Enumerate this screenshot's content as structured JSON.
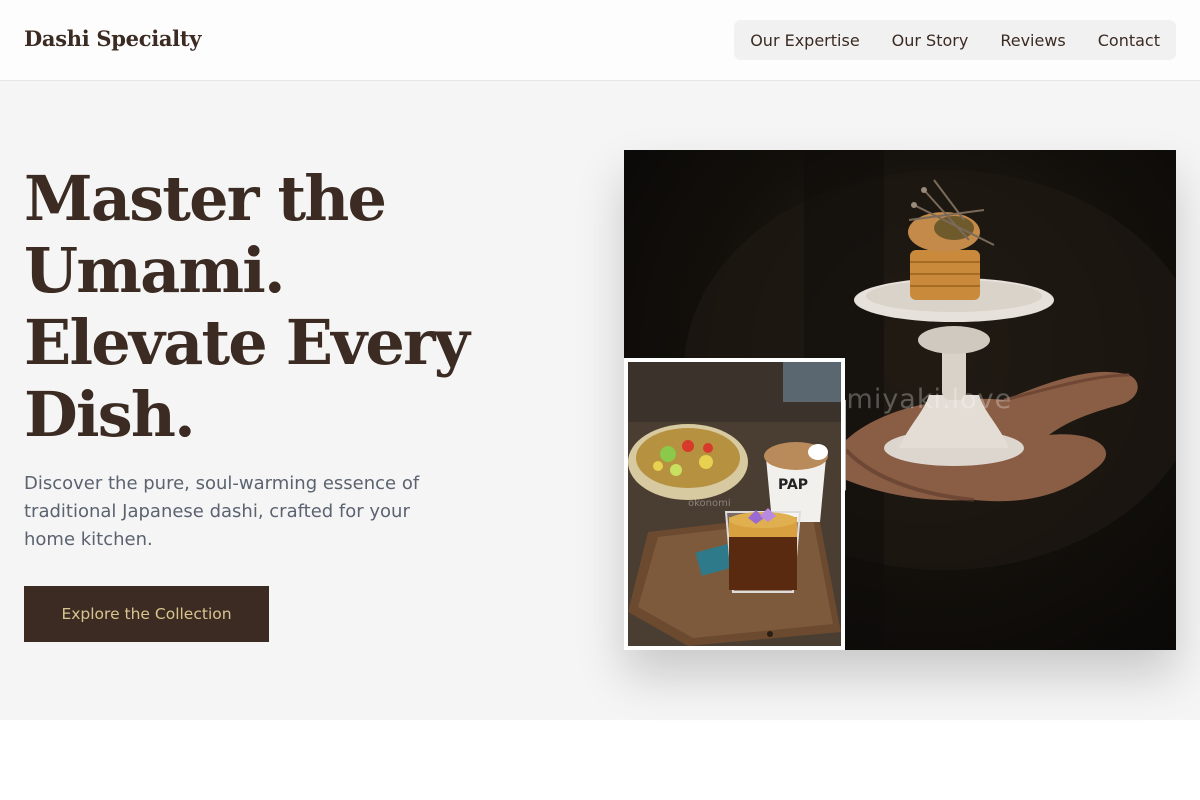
{
  "header": {
    "brand": "Dashi Specialty",
    "nav": [
      "Our Expertise",
      "Our Story",
      "Reviews",
      "Contact"
    ]
  },
  "hero": {
    "headline_lines": [
      "Master the",
      "Umami.",
      "Elevate Every",
      "Dish."
    ],
    "tagline": "Discover the pure, soul-warming essence of traditional Japanese dashi, crafted for your home kitchen.",
    "cta_label": "Explore the Collection"
  },
  "photos": {
    "main_watermark": "omiyaki.love",
    "inset_watermark": "okonomi",
    "cup_text": "PAP"
  },
  "colors": {
    "brand_brown": "#3b2b22",
    "cta_text": "#d9c48f",
    "hero_bg": "#f5f5f5"
  }
}
